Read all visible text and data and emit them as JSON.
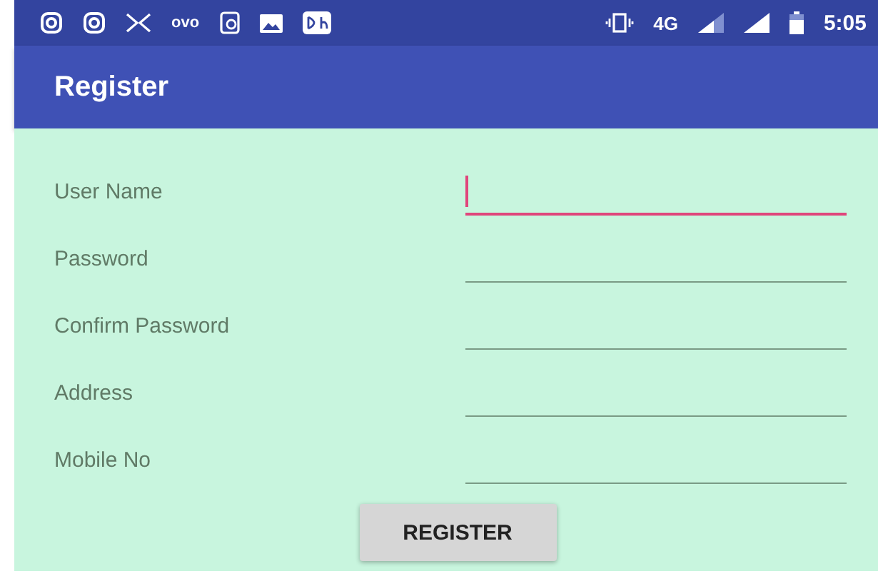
{
  "status_bar": {
    "network": "4G",
    "time": "5:05",
    "app_label": "ovo"
  },
  "app_bar": {
    "title": "Register"
  },
  "fields": [
    {
      "label": "User Name",
      "focused": true
    },
    {
      "label": "Password",
      "focused": false
    },
    {
      "label": "Confirm Password",
      "focused": false
    },
    {
      "label": "Address",
      "focused": false
    },
    {
      "label": "Mobile No",
      "focused": false
    }
  ],
  "button": "REGISTER"
}
